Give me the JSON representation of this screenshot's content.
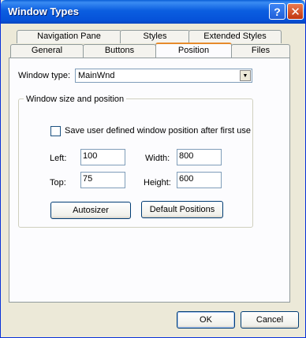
{
  "window": {
    "title": "Window Types",
    "help_glyph": "?",
    "close_glyph": "✕"
  },
  "tabs": {
    "row_back": [
      "Navigation Pane",
      "Styles",
      "Extended Styles"
    ],
    "row_front": [
      "General",
      "Buttons",
      "Position",
      "Files"
    ],
    "active": "Position"
  },
  "window_type": {
    "label": "Window type:",
    "value": "MainWnd"
  },
  "group": {
    "title": "Window size and position",
    "checkbox_label": "Save user defined window position after first use",
    "checkbox_checked": false
  },
  "fields": {
    "left_label": "Left:",
    "left_value": "100",
    "width_label": "Width:",
    "width_value": "800",
    "top_label": "Top:",
    "top_value": "75",
    "height_label": "Height:",
    "height_value": "600"
  },
  "buttons": {
    "autosizer": "Autosizer",
    "default_positions": "Default Positions",
    "ok": "OK",
    "cancel": "Cancel"
  }
}
